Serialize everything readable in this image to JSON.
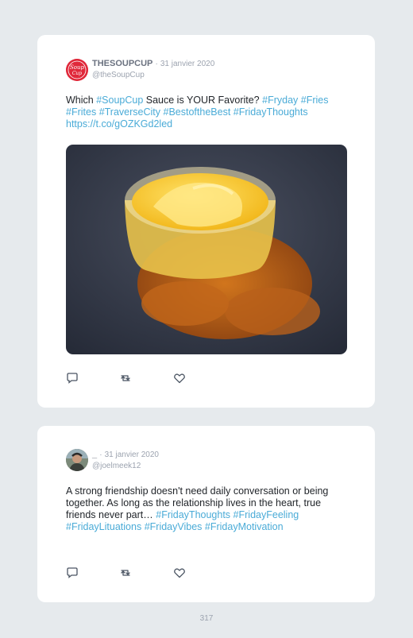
{
  "tweets": [
    {
      "author": "THESOUPCUP",
      "separator": "·",
      "date": "31 janvier 2020",
      "handle": "@theSoupCup",
      "text_parts": [
        {
          "t": "Which ",
          "tag": false
        },
        {
          "t": "#SoupCup",
          "tag": true
        },
        {
          "t": " Sauce is YOUR Favorite? ",
          "tag": false
        },
        {
          "t": "#Fryday",
          "tag": true
        },
        {
          "t": " ",
          "tag": false
        },
        {
          "t": "#Fries",
          "tag": true
        },
        {
          "t": " ",
          "tag": false
        },
        {
          "t": "#Frites",
          "tag": true
        },
        {
          "t": " ",
          "tag": false
        },
        {
          "t": "#TraverseCity",
          "tag": true
        },
        {
          "t": " ",
          "tag": false
        },
        {
          "t": "#BestoftheBest",
          "tag": true
        },
        {
          "t": " ",
          "tag": false
        },
        {
          "t": "#FridayThoughts",
          "tag": true
        },
        {
          "t": " ",
          "tag": false
        },
        {
          "t": "https://t.co/gOZKGd2led",
          "tag": true
        }
      ],
      "avatar_text": "Soup Cup"
    },
    {
      "author": "_",
      "separator": "·",
      "date": "31 janvier 2020",
      "handle": "@joelmeek12",
      "text_parts": [
        {
          "t": "A strong friendship doesn't need daily conversation or being together. As long as the relationship lives in the heart, true friends never part… ",
          "tag": false
        },
        {
          "t": "#FridayThoughts",
          "tag": true
        },
        {
          "t": " ",
          "tag": false
        },
        {
          "t": "#FridayFeeling",
          "tag": true
        },
        {
          "t": " ",
          "tag": false
        },
        {
          "t": "#FridayLituations",
          "tag": true
        },
        {
          "t": " ",
          "tag": false
        },
        {
          "t": "#FridayVibes",
          "tag": true
        },
        {
          "t": " ",
          "tag": false
        },
        {
          "t": "#FridayMotivation",
          "tag": true
        }
      ]
    }
  ],
  "icons": [
    "reply-icon",
    "retweet-icon",
    "like-icon"
  ],
  "colors": {
    "hashtag": "#4aabd7",
    "brand_red": "#e0283a",
    "background": "#e6eaed"
  },
  "page_number": "317"
}
